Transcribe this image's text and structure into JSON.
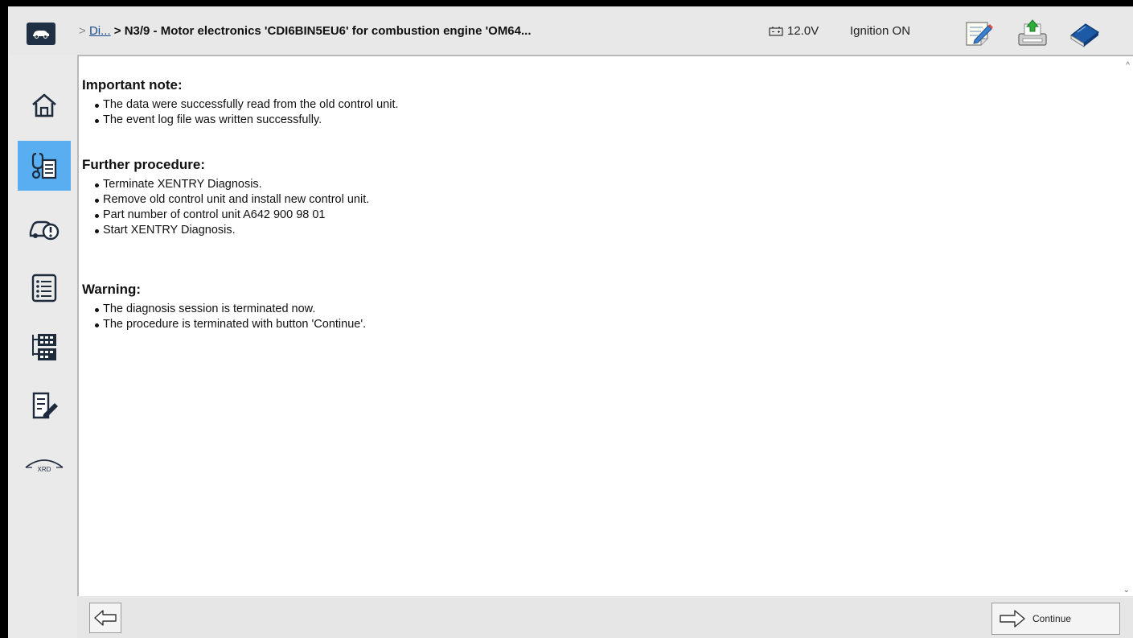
{
  "header": {
    "breadcrumb_sep": ">",
    "breadcrumb_link": "Di...",
    "breadcrumb_title": "> N3/9 - Motor electronics 'CDI6BIN5EU6' for combustion engine 'OM64...",
    "voltage": "12.0V",
    "ignition": "Ignition ON",
    "icons": [
      "car-icon",
      "notepad-pen-icon",
      "printer-upload-icon",
      "book-icon"
    ]
  },
  "sidebar": {
    "items": [
      {
        "icon": "home-icon"
      },
      {
        "icon": "diagnosis-clipboard-icon",
        "active": true
      },
      {
        "icon": "vehicle-warning-icon"
      },
      {
        "icon": "list-icon"
      },
      {
        "icon": "control-units-icon"
      },
      {
        "icon": "edit-tool-icon"
      },
      {
        "icon": "xrd-icon",
        "label": "XRD"
      }
    ]
  },
  "content": {
    "sections": [
      {
        "title": "Important note:",
        "items": [
          "The data were successfully read from the old control unit.",
          "The event log file was written successfully."
        ]
      },
      {
        "title": "Further procedure:",
        "items": [
          "Terminate XENTRY Diagnosis.",
          "Remove old control unit and install new control unit.",
          "Part number of control unit A642 900 98 01",
          "Start XENTRY Diagnosis."
        ]
      },
      {
        "title": "Warning:",
        "items": [
          "The diagnosis session is terminated now.",
          "The procedure is terminated with button 'Continue'."
        ]
      }
    ]
  },
  "footer": {
    "continue_label": "Continue"
  },
  "colors": {
    "active_sidebar": "#58aef0",
    "link": "#1a4b8c",
    "car_button": "#1f2f44"
  }
}
